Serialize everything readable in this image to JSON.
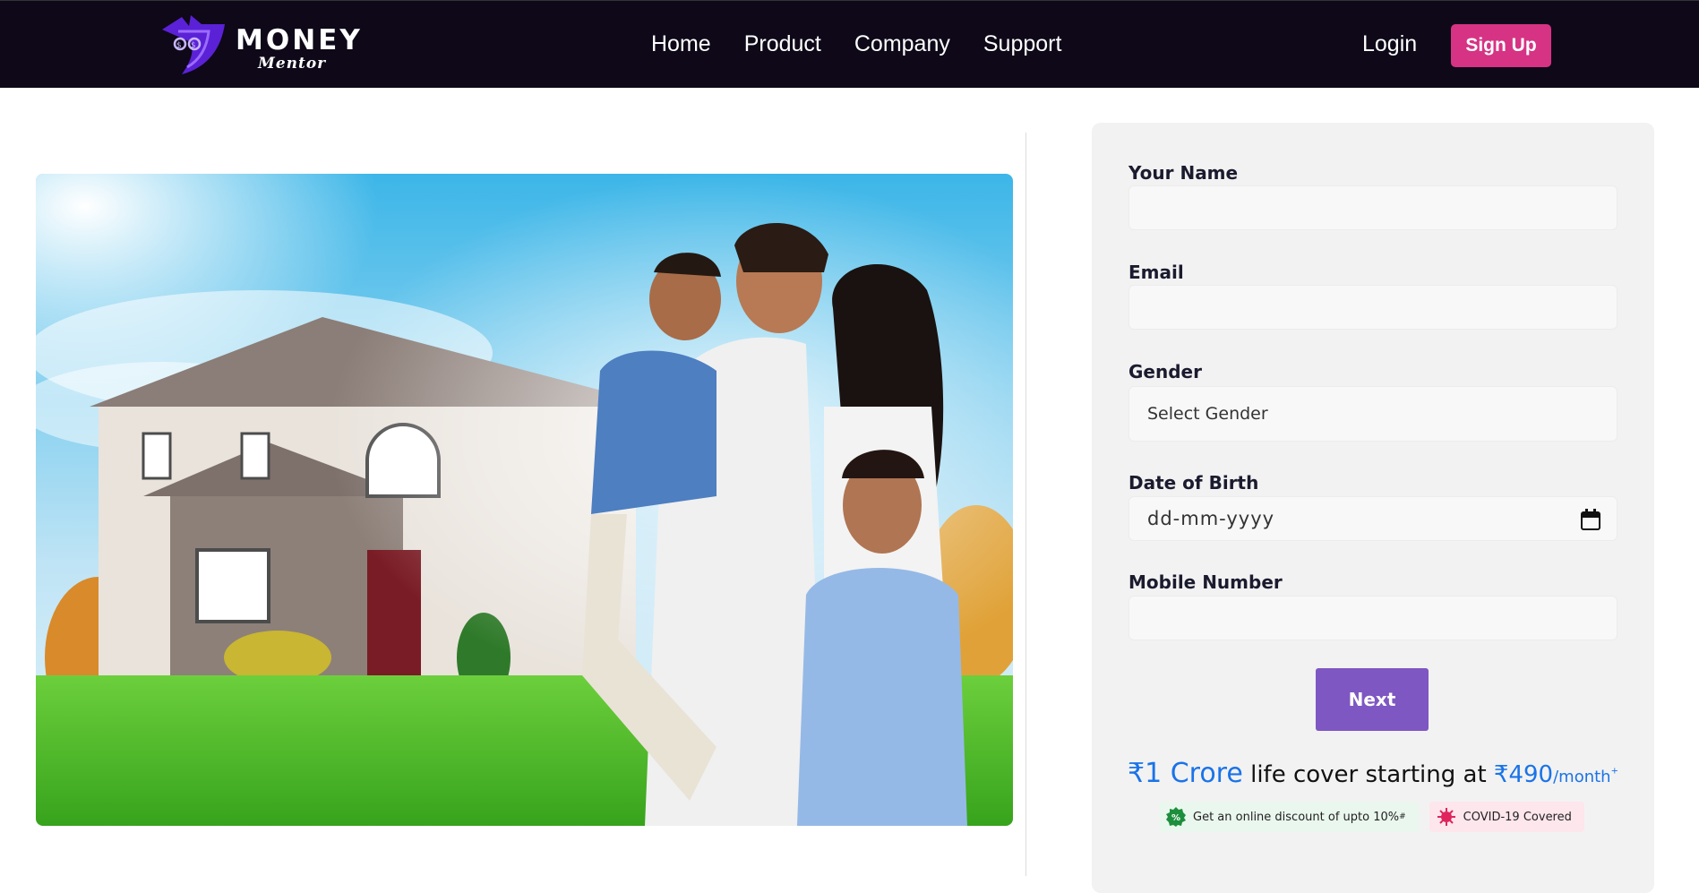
{
  "brand": {
    "name_top": "MONEY",
    "name_bottom": "Mentor",
    "accent": "#6a2ee8"
  },
  "nav": {
    "links": [
      {
        "label": "Home"
      },
      {
        "label": "Product"
      },
      {
        "label": "Company"
      },
      {
        "label": "Support"
      }
    ],
    "login_label": "Login",
    "signup_label": "Sign Up"
  },
  "hero": {
    "image": "family-in-front-of-house-photo"
  },
  "form": {
    "name_label": "Your Name",
    "name_value": "",
    "email_label": "Email",
    "email_value": "",
    "gender_label": "Gender",
    "gender_selected": "Select Gender",
    "dob_label": "Date of Birth",
    "dob_placeholder": "dd-mm-yyyy",
    "mobile_label": "Mobile Number",
    "mobile_value": "",
    "next_label": "Next"
  },
  "promo": {
    "amount": "₹1 Crore",
    "text": " life cover starting at ",
    "price": "₹490",
    "period": "/month",
    "mark": "+"
  },
  "badges": [
    {
      "icon": "percent-badge-icon",
      "text": "Get an online discount of upto 10%",
      "mark": "#"
    },
    {
      "icon": "virus-icon",
      "text": "COVID-19 Covered"
    }
  ],
  "colors": {
    "navbar_bg": "#0e0818",
    "signup_bg": "#d63384",
    "next_bg": "#7e57c2",
    "promo_blue": "#1a73e8",
    "card_bg": "#f2f2f2"
  }
}
